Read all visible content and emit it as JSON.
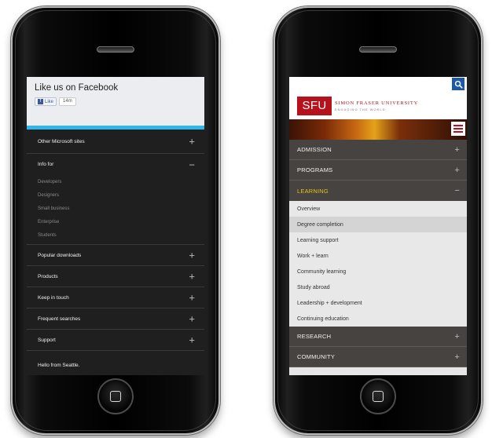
{
  "phone_left": {
    "facebook": {
      "title": "Like us on Facebook",
      "like_label": "Like",
      "like_count": "14m",
      "fb_letter": "f"
    },
    "menu": [
      {
        "label": "Other Microsoft sites",
        "symbol": "+"
      },
      {
        "label": "Info for",
        "symbol": "−"
      }
    ],
    "info_for_items": [
      "Developers",
      "Designers",
      "Small business",
      "Enterprise",
      "Students"
    ],
    "more_menu": [
      {
        "label": "Popular downloads",
        "symbol": "+"
      },
      {
        "label": "Products",
        "symbol": "+"
      },
      {
        "label": "Keep in touch",
        "symbol": "+"
      },
      {
        "label": "Frequent searches",
        "symbol": "+"
      },
      {
        "label": "Support",
        "symbol": "+"
      }
    ],
    "footer": "Hello from Seattle."
  },
  "phone_right": {
    "logo_text": "SFU",
    "university_name": "SIMON FRASER UNIVERSITY",
    "tagline": "ENGAGING THE WORLD",
    "nav_top": [
      {
        "label": "ADMISSION",
        "symbol": "+"
      },
      {
        "label": "PROGRAMS",
        "symbol": "+"
      },
      {
        "label": "LEARNING",
        "symbol": "−"
      }
    ],
    "learning_items": [
      "Overview",
      "Degree completion",
      "Learning support",
      "Work + learn",
      "Community learning",
      "Study abroad",
      "Leadership + development",
      "Continuing education"
    ],
    "selected_learning_item": "Degree completion",
    "nav_bottom": [
      {
        "label": "RESEARCH",
        "symbol": "+"
      },
      {
        "label": "COMMUNITY",
        "symbol": "+"
      }
    ]
  },
  "colors": {
    "facebook_blue": "#3b5998",
    "microsoft_accent": "#2fb6e6",
    "sfu_red": "#b5121b",
    "sfu_nav_active": "#e4c21a",
    "search_blue": "#1c5aa8"
  },
  "icons": [
    "search-icon",
    "hamburger-menu-icon",
    "home-button-icon",
    "facebook-logo-icon"
  ]
}
